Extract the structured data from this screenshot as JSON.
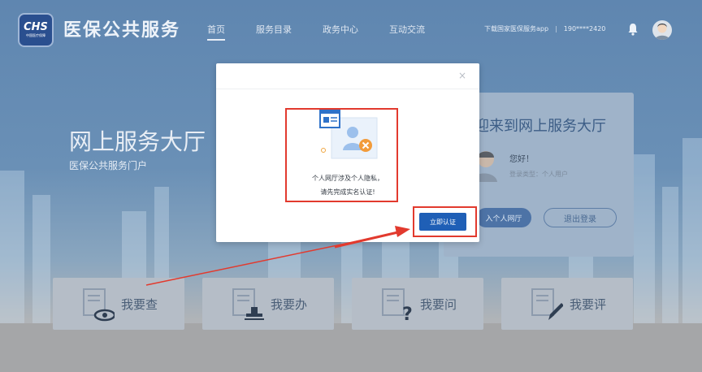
{
  "header": {
    "logo_text": "CHS",
    "logo_subtext": "中国医疗保障",
    "site_title": "医保公共服务",
    "nav": [
      {
        "label": "首页",
        "active": true
      },
      {
        "label": "服务目录",
        "active": false
      },
      {
        "label": "政务中心",
        "active": false
      },
      {
        "label": "互动交流",
        "active": false
      }
    ],
    "download_app": "下载国家医保服务app",
    "user_phone": "190****2420"
  },
  "hero": {
    "title": "网上服务大厅",
    "subtitle": "医保公共服务门户"
  },
  "welcome_card": {
    "title": "迎来到网上服务大厅",
    "greeting": "您好！",
    "login_type": "登录类型：个人用户",
    "enter_label": "入个人网厅",
    "logout_label": "退出登录"
  },
  "tiles": [
    {
      "label": "我要查",
      "icon": "eye-icon"
    },
    {
      "label": "我要办",
      "icon": "stamp-icon"
    },
    {
      "label": "我要问",
      "icon": "question-icon"
    },
    {
      "label": "我要评",
      "icon": "pen-icon"
    }
  ],
  "modal": {
    "close": "×",
    "message_line1": "个人网厅涉及个人隐私，",
    "message_line2": "请先完成实名认证!",
    "verify_button": "立即认证"
  },
  "colors": {
    "primary": "#1f5fb6",
    "annotation": "#e23a2e"
  }
}
